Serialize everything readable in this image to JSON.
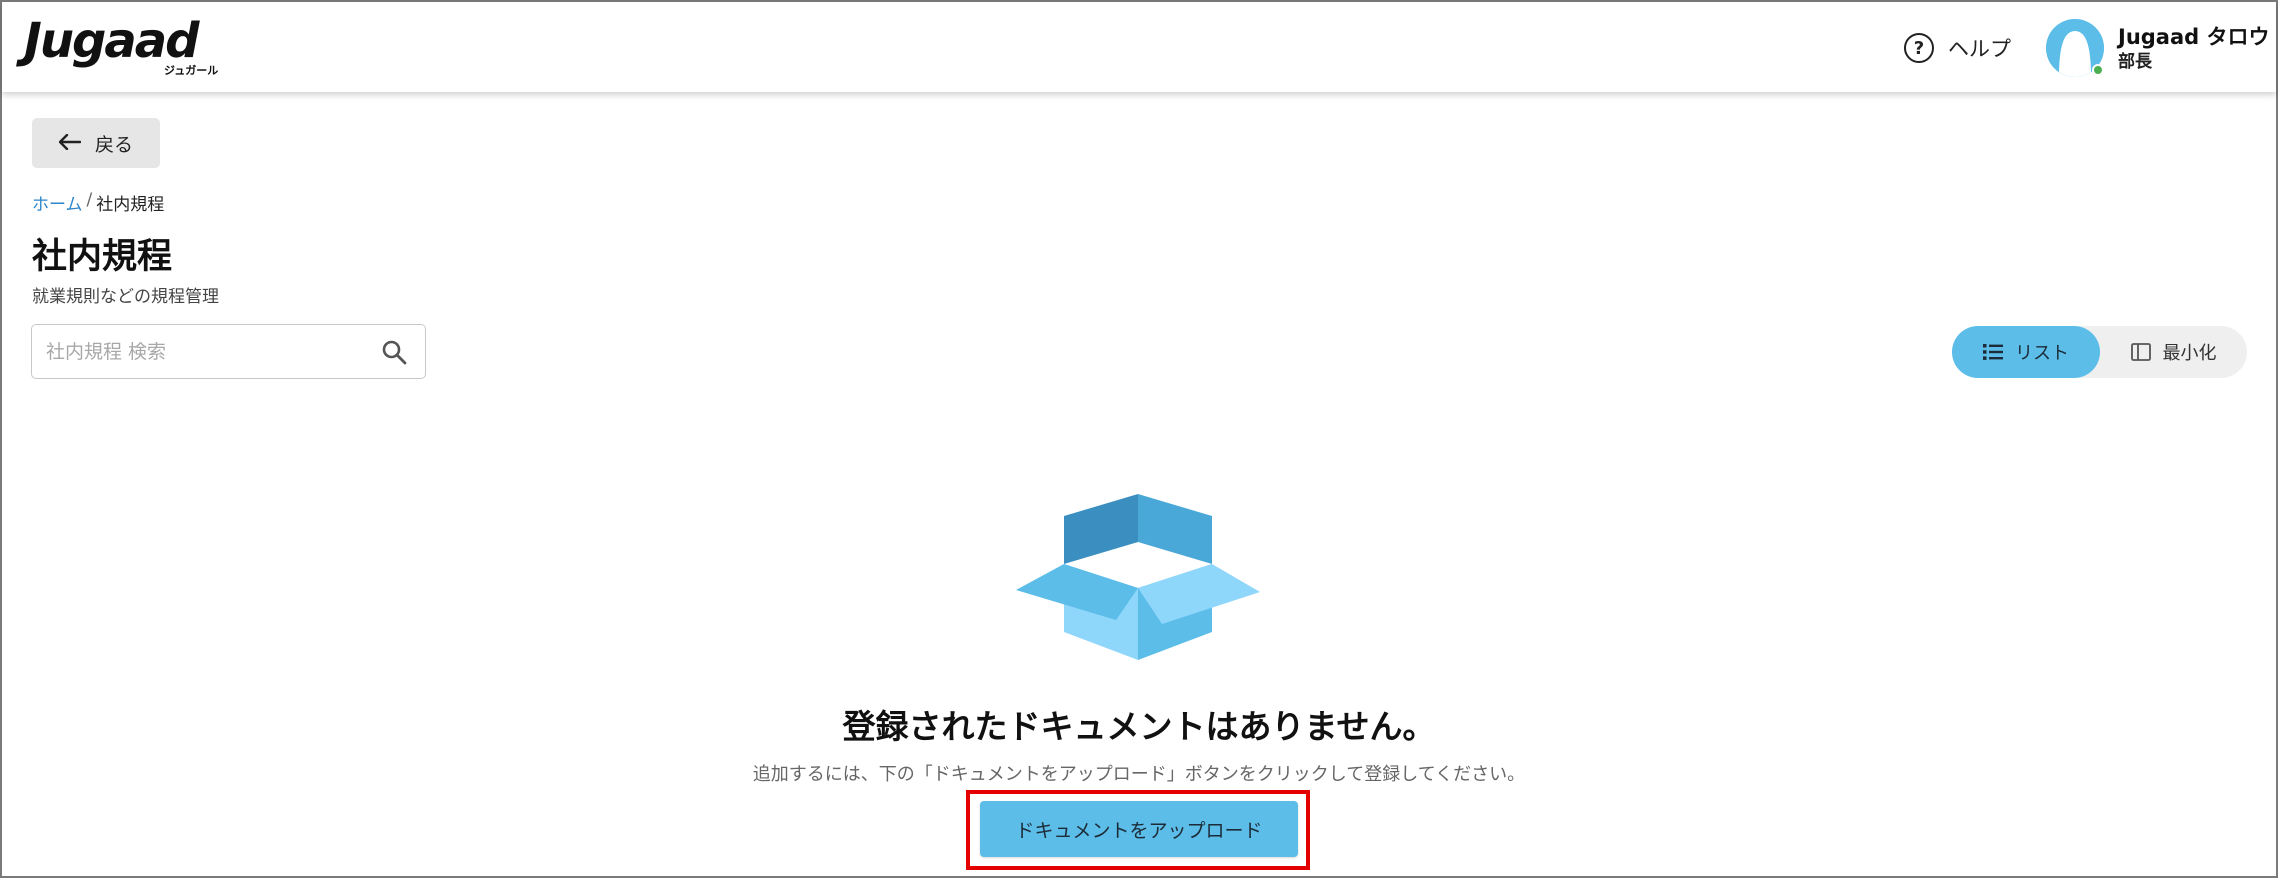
{
  "header": {
    "logo_text": "Jugaad",
    "logo_subtext": "ジュガール",
    "help_label": "ヘルプ",
    "user_name": "Jugaad タロウ",
    "user_role": "部長"
  },
  "nav": {
    "back_label": "戻る"
  },
  "breadcrumb": {
    "home": "ホーム",
    "separator": "/",
    "current": "社内規程"
  },
  "page": {
    "title": "社内規程",
    "subtitle": "就業規則などの規程管理"
  },
  "search": {
    "placeholder": "社内規程 検索",
    "value": ""
  },
  "view_toggle": {
    "list_label": "リスト",
    "minimize_label": "最小化",
    "active": "list"
  },
  "empty_state": {
    "title": "登録されたドキュメントはありません。",
    "description": "追加するには、下の「ドキュメントをアップロード」ボタンをクリックして登録してください。",
    "upload_label": "ドキュメントをアップロード"
  },
  "colors": {
    "accent": "#5bbde8",
    "highlight_border": "#e50000",
    "link": "#2f86c9",
    "status_online": "#4caf50"
  },
  "icons": {
    "help": "question-circle-icon",
    "back": "arrow-left-icon",
    "search": "search-icon",
    "list": "list-icon",
    "minimize": "sidebar-panel-icon",
    "empty": "open-box-icon"
  }
}
